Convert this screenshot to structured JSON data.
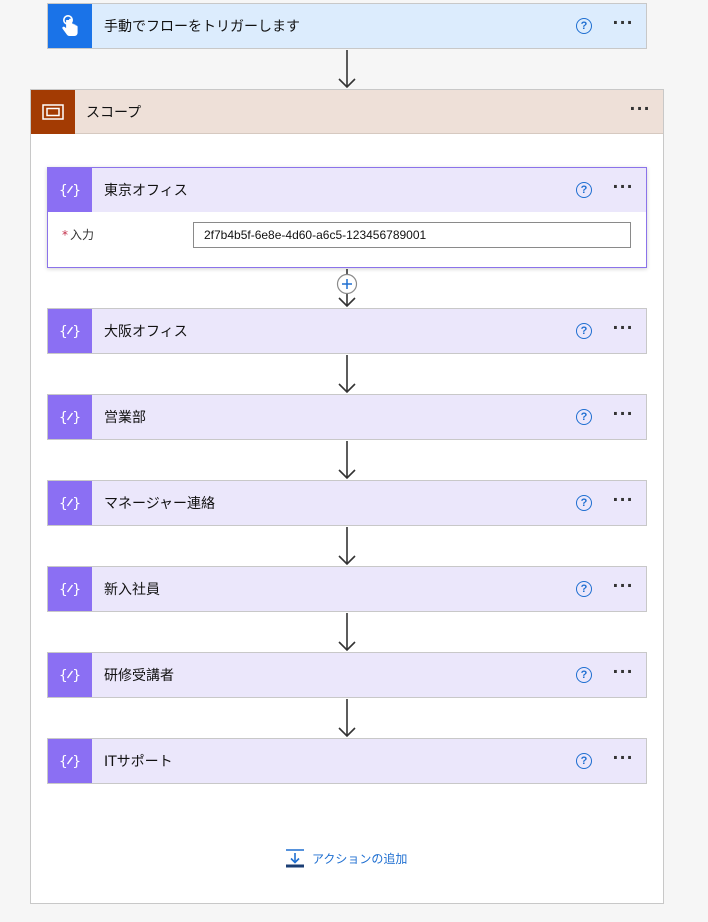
{
  "trigger": {
    "title": "手動でフローをトリガーします",
    "help": "?",
    "more": "···",
    "icon": "hand-touch-icon"
  },
  "scope": {
    "title": "スコープ",
    "more": "···",
    "icon": "scope-icon"
  },
  "expanded_action": {
    "title": "東京オフィス",
    "help": "?",
    "more": "···",
    "icon": "variable-icon",
    "field": {
      "required_mark": "*",
      "label": "入力",
      "value": "2f7b4b5f-6e8e-4d60-a6c5-123456789001"
    }
  },
  "actions": [
    {
      "title": "大阪オフィス",
      "help": "?",
      "more": "···"
    },
    {
      "title": "営業部",
      "help": "?",
      "more": "···"
    },
    {
      "title": "マネージャー連絡",
      "help": "?",
      "more": "···"
    },
    {
      "title": "新入社員",
      "help": "?",
      "more": "···"
    },
    {
      "title": "研修受講者",
      "help": "?",
      "more": "···"
    },
    {
      "title": "ITサポート",
      "help": "?",
      "more": "···"
    }
  ],
  "add_action": {
    "label": "アクションの追加",
    "icon": "add-action-icon"
  },
  "colors": {
    "trigger_bg": "#dcecfd",
    "trigger_icon": "#1a73e8",
    "scope_header_bg": "#eee0d8",
    "scope_icon": "#a33b03",
    "action_bg": "#ebe7fb",
    "action_icon": "#8b6ff3",
    "link": "#1f6fd1"
  }
}
